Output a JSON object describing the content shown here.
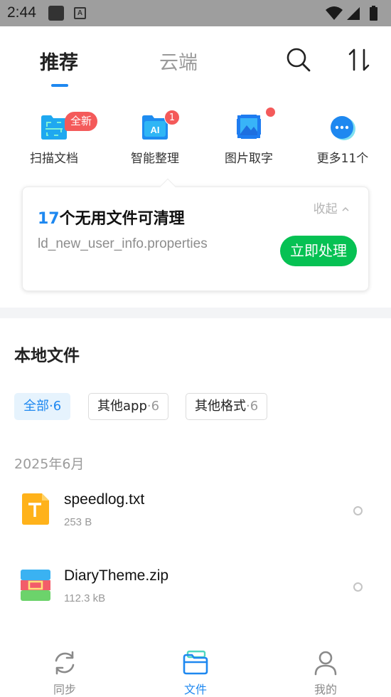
{
  "status_bar": {
    "time": "2:44",
    "icons": [
      "stop-square-icon",
      "a-box-icon",
      "wifi-icon",
      "signal-icon",
      "battery-icon"
    ]
  },
  "header": {
    "tabs": [
      {
        "label": "推荐",
        "active": true
      },
      {
        "label": "云端",
        "active": false
      }
    ],
    "icons": [
      "search-icon",
      "sort-icon"
    ]
  },
  "tools": [
    {
      "label": "扫描文档",
      "icon": "scan-document-icon",
      "badge": "全新"
    },
    {
      "label": "智能整理",
      "icon": "ai-organize-icon",
      "badge": "1"
    },
    {
      "label": "图片取字",
      "icon": "image-text-icon",
      "badge": "dot"
    },
    {
      "label": "更多11个",
      "icon": "more-icon",
      "badge": ""
    }
  ],
  "cleanup_card": {
    "count": "17",
    "title_rest": "个无用文件可清理",
    "file": "ld_new_user_info.properties",
    "collapse": "收起",
    "action": "立即处理"
  },
  "local_files": {
    "title": "本地文件",
    "filters": [
      {
        "label": "全部",
        "count": "·6",
        "active": true
      },
      {
        "label": "其他app",
        "count": "·6",
        "active": false
      },
      {
        "label": "其他格式",
        "count": "·6",
        "active": false
      }
    ],
    "date_group": "2025年6月",
    "files": [
      {
        "name": "speedlog.txt",
        "size": "253 B",
        "icon": "text-file-icon"
      },
      {
        "name": "DiaryTheme.zip",
        "size": "112.3 kB",
        "icon": "zip-file-icon"
      }
    ]
  },
  "bottom_nav": [
    {
      "label": "同步",
      "icon": "sync-icon",
      "active": false
    },
    {
      "label": "文件",
      "icon": "folder-icon",
      "active": true
    },
    {
      "label": "我的",
      "icon": "profile-icon",
      "active": false
    }
  ],
  "colors": {
    "accent": "#1e88f0",
    "action_green": "#06c153",
    "badge_red": "#f45a5a"
  }
}
